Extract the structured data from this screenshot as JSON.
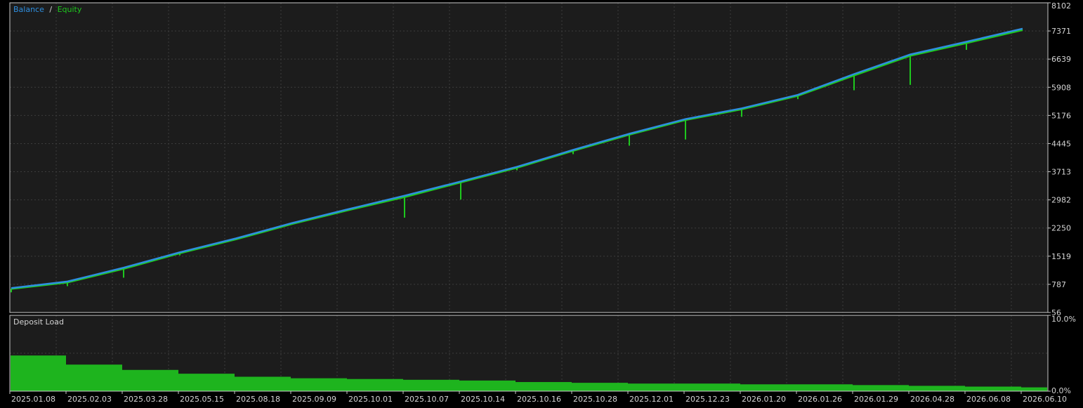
{
  "colors": {
    "background": "#000000",
    "plot_background": "#1c1c1c",
    "frame": "#c8c8c8",
    "grid": "#3c3c3c",
    "axis_text": "#d4d4d4",
    "balance": "#2e8fe0",
    "equity": "#1ec81e",
    "deposit_load": "#1eb41e"
  },
  "chart_data": [
    {
      "type": "line",
      "legend": {
        "placement": "top-left",
        "separator": "/"
      },
      "series": [
        {
          "name": "Balance",
          "x": [
            "2025.01.08",
            "2025.02.03",
            "2025.03.28",
            "2025.05.15",
            "2025.08.18",
            "2025.09.09",
            "2025.10.01",
            "2025.10.07",
            "2025.10.14",
            "2025.10.16",
            "2025.10.28",
            "2025.12.01",
            "2025.12.23",
            "2026.01.20",
            "2026.01.26",
            "2026.01.29",
            "2026.04.28",
            "2026.06.08",
            "2026.06.10"
          ],
          "values": [
            690,
            860,
            1220,
            1620,
            1980,
            2380,
            2740,
            3090,
            3460,
            3840,
            4280,
            4700,
            5080,
            5360,
            5710,
            6250,
            6760,
            7090,
            7430
          ]
        },
        {
          "name": "Equity",
          "x": [
            "2025.01.08",
            "2025.02.03",
            "2025.03.28",
            "2025.05.15",
            "2025.08.18",
            "2025.09.09",
            "2025.10.01",
            "2025.10.07",
            "2025.10.14",
            "2025.10.16",
            "2025.10.28",
            "2025.12.01",
            "2025.12.23",
            "2026.01.20",
            "2026.01.26",
            "2026.01.29",
            "2026.04.28",
            "2026.06.08",
            "2026.06.10"
          ],
          "values": [
            675,
            840,
            1195,
            1600,
            1960,
            2360,
            2720,
            3060,
            3440,
            3820,
            4260,
            4680,
            5060,
            5340,
            5690,
            6220,
            6730,
            7060,
            7400
          ],
          "drawdowns": [
            {
              "x": "2025.01.08",
              "low": 580
            },
            {
              "x": "2025.02.03",
              "low": 740
            },
            {
              "x": "2025.03.28",
              "low": 960
            },
            {
              "x": "2025.05.15",
              "low": 1540
            },
            {
              "x": "2025.10.07",
              "low": 2520
            },
            {
              "x": "2025.10.14",
              "low": 2990
            },
            {
              "x": "2025.10.16",
              "low": 3750
            },
            {
              "x": "2025.10.28",
              "low": 4170
            },
            {
              "x": "2025.12.01",
              "low": 4390
            },
            {
              "x": "2025.12.23",
              "low": 4550
            },
            {
              "x": "2026.01.20",
              "low": 5140
            },
            {
              "x": "2026.01.26",
              "low": 5600
            },
            {
              "x": "2026.01.29",
              "low": 5830
            },
            {
              "x": "2026.04.28",
              "low": 5970
            },
            {
              "x": "2026.06.08",
              "low": 6880
            }
          ]
        }
      ],
      "yticks": [
        "8102",
        "7371",
        "6639",
        "5908",
        "5176",
        "4445",
        "3713",
        "2982",
        "2250",
        "1519",
        "787",
        "56"
      ],
      "ylim": [
        56,
        8102
      ],
      "grid": true
    },
    {
      "type": "bar",
      "title": "Deposit Load",
      "series": [
        {
          "name": "Deposit Load",
          "x": [
            "2025.01.08",
            "2025.02.03",
            "2025.03.28",
            "2025.05.15",
            "2025.08.18",
            "2025.09.09",
            "2025.10.01",
            "2025.10.07",
            "2025.10.14",
            "2025.10.16",
            "2025.10.28",
            "2025.12.01",
            "2025.12.23",
            "2026.01.20",
            "2026.01.26",
            "2026.01.29",
            "2026.04.28",
            "2026.06.08",
            "2026.06.10"
          ],
          "values": [
            4.7,
            3.5,
            2.8,
            2.3,
            1.9,
            1.7,
            1.6,
            1.5,
            1.4,
            1.2,
            1.1,
            1.0,
            1.0,
            0.9,
            0.9,
            0.8,
            0.7,
            0.6,
            0.5
          ]
        }
      ],
      "yticks": [
        "10.0%",
        "0.0%"
      ],
      "ylim": [
        0,
        10
      ],
      "grid": true
    }
  ],
  "x_axis": {
    "tick_labels": [
      "2025.01.08",
      "2025.02.03",
      "2025.03.28",
      "2025.05.15",
      "2025.08.18",
      "2025.09.09",
      "2025.10.01",
      "2025.10.07",
      "2025.10.14",
      "2025.10.16",
      "2025.10.28",
      "2025.12.01",
      "2025.12.23",
      "2026.01.20",
      "2026.01.26",
      "2026.01.29",
      "2026.04.28",
      "2026.06.08",
      "2026.06.10"
    ]
  }
}
